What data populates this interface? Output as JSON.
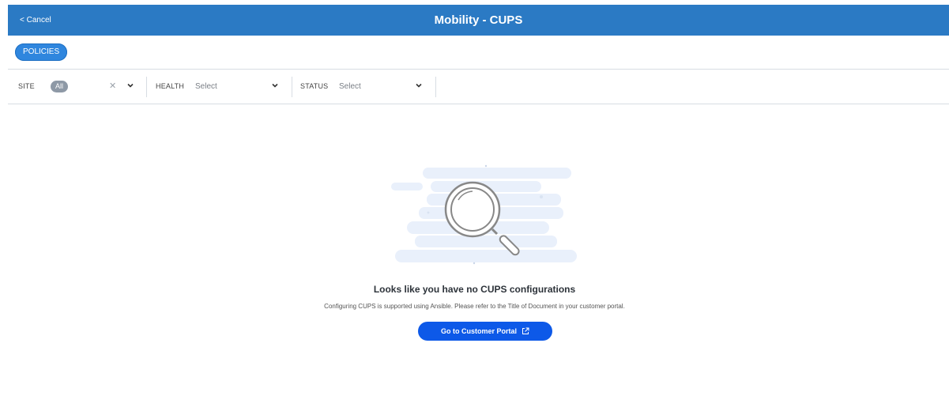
{
  "header": {
    "cancel_label": "< Cancel",
    "title": "Mobility - CUPS",
    "bg_color": "#2b7ac4"
  },
  "tabs": {
    "policies_label": "POLICIES"
  },
  "filters": {
    "site": {
      "label": "SITE",
      "value": "All"
    },
    "health": {
      "label": "HEALTH",
      "placeholder": "Select"
    },
    "status": {
      "label": "STATUS",
      "placeholder": "Select"
    }
  },
  "empty_state": {
    "icon": "magnifier-icon",
    "title": "Looks like you have no CUPS configurations",
    "subtitle": "Configuring CUPS is supported using Ansible. Please refer to the Title of Document in your customer portal.",
    "button_label": "Go to Customer Portal",
    "button_icon": "external-link-icon",
    "button_color": "#0d59e8"
  }
}
